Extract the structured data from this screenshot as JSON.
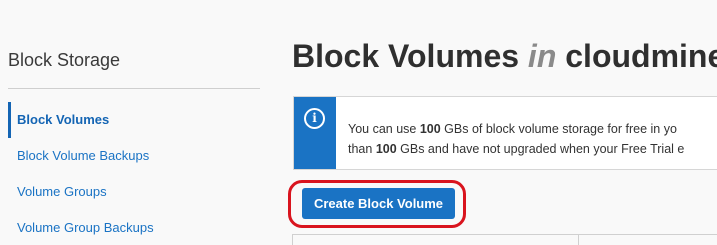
{
  "sidebar": {
    "title": "Block Storage",
    "items": [
      {
        "label": "Block Volumes",
        "active": true
      },
      {
        "label": "Block Volume Backups"
      },
      {
        "label": "Volume Groups"
      },
      {
        "label": "Volume Group Backups"
      }
    ]
  },
  "main": {
    "title_prefix": "Block Volumes",
    "title_in": "in",
    "title_compartment": "cloudmine",
    "banner": {
      "icon": "info-icon",
      "line1_start": "You can use ",
      "line1_bold": "100",
      "line1_end": " GBs of block volume storage for free in yo",
      "line2_start": "than ",
      "line2_bold": "100",
      "line2_end": " GBs and have not upgraded when your Free Trial e"
    },
    "create_button": "Create Block Volume"
  },
  "colors": {
    "accent": "#1a73c4",
    "annotation": "#d9141e"
  }
}
